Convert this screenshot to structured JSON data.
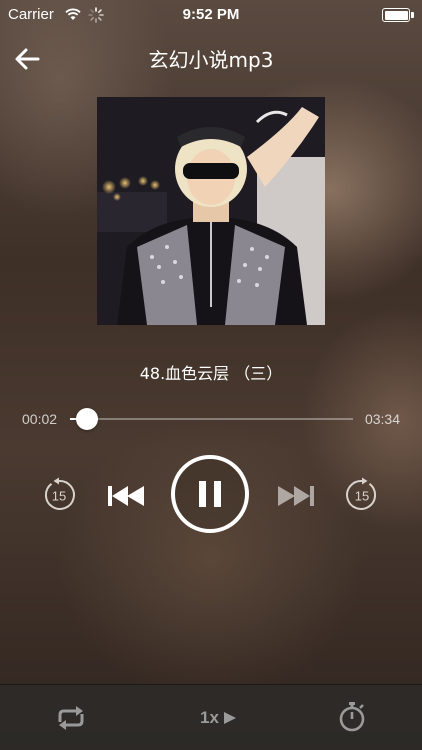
{
  "status_bar": {
    "carrier": "Carrier",
    "time": "9:52 PM",
    "icons": [
      "wifi-icon",
      "activity-spinner-icon",
      "battery-icon"
    ]
  },
  "nav": {
    "title": "玄幻小说mp3",
    "back_icon": "back-arrow-icon"
  },
  "player": {
    "track_title": "48.血色云层 （三）",
    "current_time": "00:02",
    "total_time": "03:34",
    "progress_fraction": 0.01,
    "state": "playing",
    "controls": {
      "rewind_label": "15",
      "forward_label": "15",
      "rewind_icon": "rewind-15-icon",
      "prev_icon": "skip-previous-icon",
      "pause_icon": "pause-icon",
      "next_icon": "skip-next-icon",
      "forward_icon": "forward-15-icon"
    }
  },
  "bottom_bar": {
    "speed_label": "1x",
    "repeat_icon": "repeat-icon",
    "speed_icon": "play-speed-icon",
    "timer_icon": "stopwatch-icon"
  },
  "colors": {
    "accent": "#ffffff",
    "bottom_bar_bg": "#2d2a28",
    "inactive_icon": "#9a9a9a"
  }
}
